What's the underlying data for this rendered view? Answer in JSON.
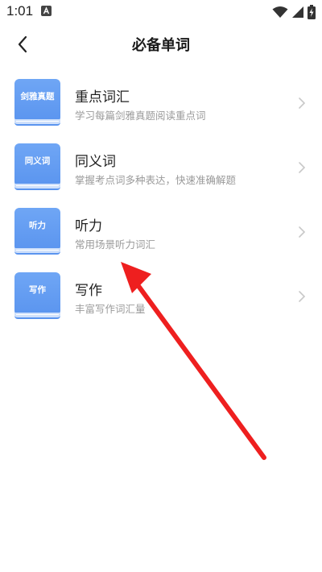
{
  "status_bar": {
    "time": "1:01"
  },
  "header": {
    "title": "必备单词"
  },
  "items": [
    {
      "cover_label": "剑雅真题",
      "title": "重点词汇",
      "subtitle": "学习每篇剑雅真题阅读重点词"
    },
    {
      "cover_label": "同义词",
      "title": "同义词",
      "subtitle": "掌握考点词多种表达，快速准确解题"
    },
    {
      "cover_label": "听力",
      "title": "听力",
      "subtitle": "常用场景听力词汇"
    },
    {
      "cover_label": "写作",
      "title": "写作",
      "subtitle": "丰富写作词汇量"
    }
  ],
  "colors": {
    "book_blue": "#5b95ef",
    "annotation_red": "#ee1f1f"
  },
  "icons": [
    "back-icon",
    "chevron-right-icon",
    "book-icon",
    "wifi-icon",
    "signal-icon",
    "battery-icon"
  ]
}
